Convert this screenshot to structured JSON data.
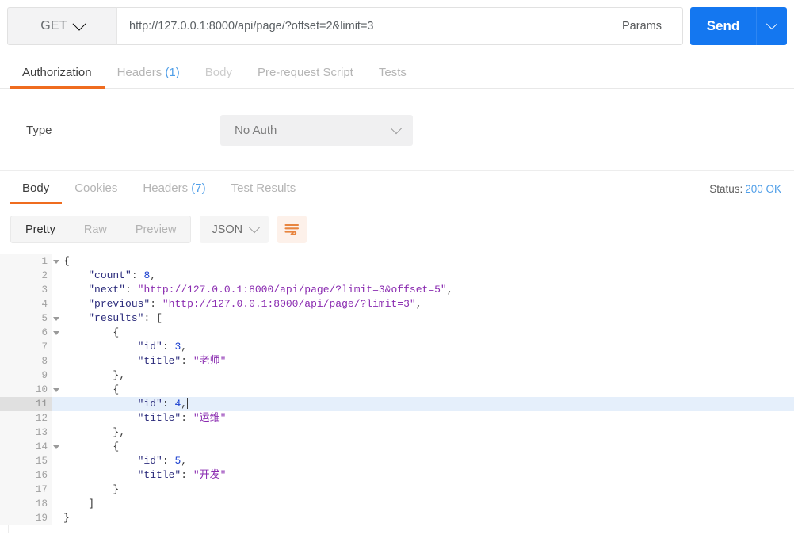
{
  "request": {
    "method": "GET",
    "url": "http://127.0.0.1:8000/api/page/?offset=2&limit=3",
    "params_label": "Params",
    "send_label": "Send",
    "accent_blue": "#1477f0",
    "tabs": [
      {
        "label": "Authorization",
        "count": "",
        "active": true,
        "dim": false
      },
      {
        "label": "Headers",
        "count": "(1)",
        "active": false,
        "dim": false
      },
      {
        "label": "Body",
        "count": "",
        "active": false,
        "dim": true
      },
      {
        "label": "Pre-request Script",
        "count": "",
        "active": false,
        "dim": false
      },
      {
        "label": "Tests",
        "count": "",
        "active": false,
        "dim": false
      }
    ]
  },
  "auth": {
    "type_label": "Type",
    "type_value": "No Auth"
  },
  "response": {
    "tabs": [
      {
        "label": "Body",
        "count": "",
        "active": true
      },
      {
        "label": "Cookies",
        "count": "",
        "active": false
      },
      {
        "label": "Headers",
        "count": "(7)",
        "active": false
      },
      {
        "label": "Test Results",
        "count": "",
        "active": false
      }
    ],
    "status_label": "Status:",
    "status_code": "200 OK",
    "status_color": "#4f9ee8",
    "accent_orange": "#ef6c1f",
    "view_modes": [
      {
        "label": "Pretty",
        "active": true
      },
      {
        "label": "Raw",
        "active": false
      },
      {
        "label": "Preview",
        "active": false
      }
    ],
    "format": "JSON",
    "wrap_icon": "word-wrap-icon"
  },
  "code": {
    "active_line": 11,
    "fold_lines": [
      1,
      5,
      6,
      10,
      14
    ],
    "lines": [
      {
        "n": 1,
        "html": "<span class=\"tok-brace\">{</span>"
      },
      {
        "n": 2,
        "html": "    <span class=\"tok-key\">\"count\"</span><span class=\"tok-punc\">:</span> <span class=\"tok-num\">8</span><span class=\"tok-punc\">,</span>"
      },
      {
        "n": 3,
        "html": "    <span class=\"tok-key\">\"next\"</span><span class=\"tok-punc\">:</span> <span class=\"tok-str\">\"http://127.0.0.1:8000/api/page/?limit=3&amp;offset=5\"</span><span class=\"tok-punc\">,</span>"
      },
      {
        "n": 4,
        "html": "    <span class=\"tok-key\">\"previous\"</span><span class=\"tok-punc\">:</span> <span class=\"tok-str\">\"http://127.0.0.1:8000/api/page/?limit=3\"</span><span class=\"tok-punc\">,</span>"
      },
      {
        "n": 5,
        "html": "    <span class=\"tok-key\">\"results\"</span><span class=\"tok-punc\">:</span> <span class=\"tok-brace\">[</span>"
      },
      {
        "n": 6,
        "html": "        <span class=\"tok-brace\">{</span>"
      },
      {
        "n": 7,
        "html": "            <span class=\"tok-key\">\"id\"</span><span class=\"tok-punc\">:</span> <span class=\"tok-num\">3</span><span class=\"tok-punc\">,</span>"
      },
      {
        "n": 8,
        "html": "            <span class=\"tok-key\">\"title\"</span><span class=\"tok-punc\">:</span> <span class=\"tok-str\">\"老师\"</span>"
      },
      {
        "n": 9,
        "html": "        <span class=\"tok-brace\">}</span><span class=\"tok-punc\">,</span>"
      },
      {
        "n": 10,
        "html": "        <span class=\"tok-brace\">{</span>"
      },
      {
        "n": 11,
        "html": "            <span class=\"tok-key\">\"id\"</span><span class=\"tok-punc\">:</span> <span class=\"tok-num\">4</span><span class=\"tok-punc\">,</span><span class=\"caret-bar\"></span>"
      },
      {
        "n": 12,
        "html": "            <span class=\"tok-key\">\"title\"</span><span class=\"tok-punc\">:</span> <span class=\"tok-str\">\"运维\"</span>"
      },
      {
        "n": 13,
        "html": "        <span class=\"tok-brace\">}</span><span class=\"tok-punc\">,</span>"
      },
      {
        "n": 14,
        "html": "        <span class=\"tok-brace\">{</span>"
      },
      {
        "n": 15,
        "html": "            <span class=\"tok-key\">\"id\"</span><span class=\"tok-punc\">:</span> <span class=\"tok-num\">5</span><span class=\"tok-punc\">,</span>"
      },
      {
        "n": 16,
        "html": "            <span class=\"tok-key\">\"title\"</span><span class=\"tok-punc\">:</span> <span class=\"tok-str\">\"开发\"</span>"
      },
      {
        "n": 17,
        "html": "        <span class=\"tok-brace\">}</span>"
      },
      {
        "n": 18,
        "html": "    <span class=\"tok-brace\">]</span>"
      },
      {
        "n": 19,
        "html": "<span class=\"tok-brace\">}</span>"
      }
    ],
    "json_value": {
      "count": 8,
      "next": "http://127.0.0.1:8000/api/page/?limit=3&offset=5",
      "previous": "http://127.0.0.1:8000/api/page/?limit=3",
      "results": [
        {
          "id": 3,
          "title": "老师"
        },
        {
          "id": 4,
          "title": "运维"
        },
        {
          "id": 5,
          "title": "开发"
        }
      ]
    }
  }
}
